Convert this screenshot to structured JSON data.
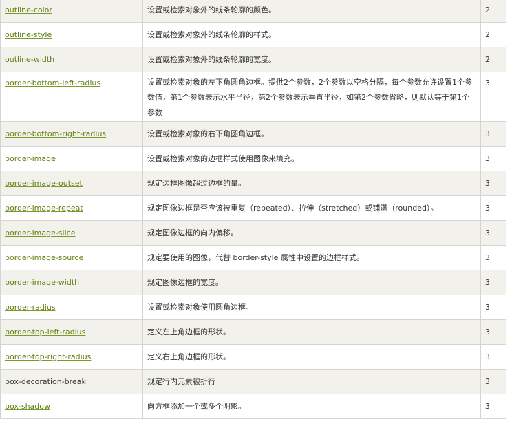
{
  "rows": [
    {
      "property": "outline-color",
      "linked": true,
      "description": "设置或检索对象外的线条轮廓的颜色。",
      "version": "2"
    },
    {
      "property": "outline-style",
      "linked": true,
      "description": "设置或检索对象外的线条轮廓的样式。",
      "version": "2"
    },
    {
      "property": "outline-width",
      "linked": true,
      "description": "设置或检索对象外的线条轮廓的宽度。",
      "version": "2"
    },
    {
      "property": "border-bottom-left-radius",
      "linked": true,
      "description": "设置或检索对象的左下角圆角边框。提供2个参数，2个参数以空格分隔，每个参数允许设置1个参数值，第1个参数表示水平半径，第2个参数表示垂直半径，如第2个参数省略，则默认等于第1个参数",
      "version": "3"
    },
    {
      "property": "border-bottom-right-radius",
      "linked": true,
      "description": "设置或检索对象的右下角圆角边框。",
      "version": "3"
    },
    {
      "property": "border-image",
      "linked": true,
      "description": "设置或检索对象的边框样式使用图像来填充。",
      "version": "3"
    },
    {
      "property": "border-image-outset",
      "linked": true,
      "description": "规定边框图像超过边框的量。",
      "version": "3"
    },
    {
      "property": "border-image-repeat",
      "linked": true,
      "description": "规定图像边框是否应该被重复（repeated）、拉伸（stretched）或铺满（rounded）。",
      "version": "3"
    },
    {
      "property": "border-image-slice",
      "linked": true,
      "description": "规定图像边框的向内偏移。",
      "version": "3"
    },
    {
      "property": "border-image-source",
      "linked": true,
      "description": "规定要使用的图像，代替 border-style 属性中设置的边框样式。",
      "version": "3"
    },
    {
      "property": "border-image-width",
      "linked": true,
      "description": "规定图像边框的宽度。",
      "version": "3"
    },
    {
      "property": "border-radius",
      "linked": true,
      "description": "设置或检索对象使用圆角边框。",
      "version": "3"
    },
    {
      "property": "border-top-left-radius",
      "linked": true,
      "description": "定义左上角边框的形状。",
      "version": "3"
    },
    {
      "property": "border-top-right-radius",
      "linked": true,
      "description": "定义右上角边框的形状。",
      "version": "3"
    },
    {
      "property": "box-decoration-break",
      "linked": false,
      "description": "规定行内元素被折行",
      "version": "3"
    },
    {
      "property": "box-shadow",
      "linked": true,
      "description": "向方框添加一个或多个阴影。",
      "version": "3"
    }
  ],
  "colors": {
    "link": "#617f10",
    "row_alt_bg": "#f2f1eb",
    "border": "#d4d4d4"
  }
}
